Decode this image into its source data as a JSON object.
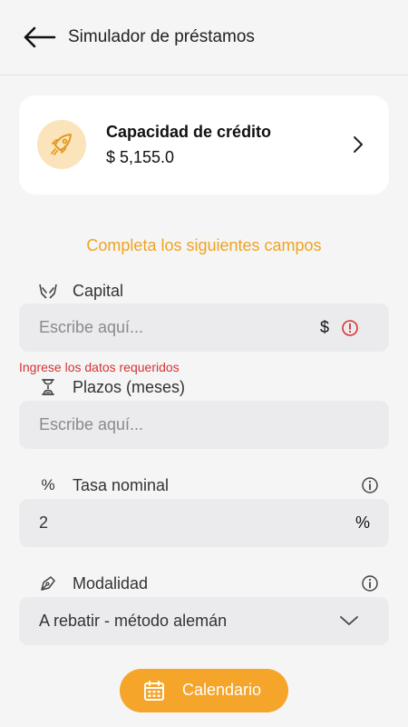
{
  "header": {
    "back_icon": "arrow-left-icon",
    "title": "Simulador de préstamos"
  },
  "credit_card": {
    "icon": "rocket-icon",
    "title": "Capacidad de crédito",
    "amount": "$ 5,155.0",
    "chevron_icon": "chevron-right-icon"
  },
  "form": {
    "section_title": "Completa los siguientes campos",
    "capital": {
      "icon": "hands-coin-icon",
      "label": "Capital",
      "placeholder": "Escribe aquí...",
      "value": "",
      "suffix": "$",
      "error_icon": "alert-circle-icon",
      "error_message": "Ingrese los datos requeridos"
    },
    "plazos": {
      "icon": "hourglass-icon",
      "label": "Plazos (meses)",
      "placeholder": "Escribe aquí...",
      "value": ""
    },
    "tasa": {
      "icon_text": "%",
      "label": "Tasa nominal",
      "value": "2",
      "suffix": "%",
      "info_icon": "info-icon"
    },
    "modalidad": {
      "icon": "pen-nib-icon",
      "label": "Modalidad",
      "selected": "A rebatir - método alemán",
      "info_icon": "info-icon",
      "dropdown_icon": "chevron-down-icon"
    }
  },
  "calendar_button": {
    "icon": "calendar-icon",
    "label": "Calendario"
  },
  "colors": {
    "accent": "#f0a320",
    "button": "#f4a52a",
    "error": "#d63333",
    "rocket_bg": "#fbe3bb",
    "input_bg": "#ebebee",
    "page_bg": "#f5f5f5"
  }
}
